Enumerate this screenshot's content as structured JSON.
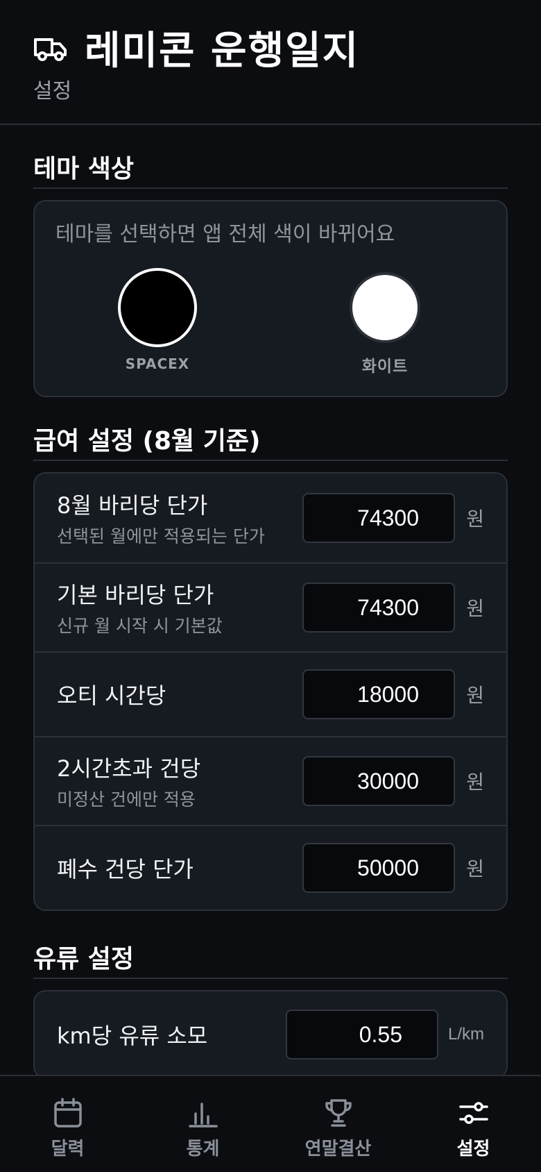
{
  "header": {
    "title": "레미콘 운행일지",
    "subtitle": "설정"
  },
  "theme": {
    "section_title": "테마 색상",
    "hint": "테마를 선택하면 앱 전체 색이 바뀌어요",
    "options": [
      {
        "label": "SPACEX",
        "color": "#000000",
        "selected": true
      },
      {
        "label": "화이트",
        "color": "#ffffff",
        "selected": false
      }
    ]
  },
  "pay": {
    "section_title": "급여 설정 (8월 기준)",
    "rows": [
      {
        "title": "8월 바리당 단가",
        "sub": "선택된 월에만 적용되는 단가",
        "value": "74300",
        "unit": "원"
      },
      {
        "title": "기본 바리당 단가",
        "sub": "신규 월 시작 시 기본값",
        "value": "74300",
        "unit": "원"
      },
      {
        "title": "오티 시간당",
        "sub": "",
        "value": "18000",
        "unit": "원"
      },
      {
        "title": "2시간초과 건당",
        "sub": "미정산 건에만 적용",
        "value": "30000",
        "unit": "원"
      },
      {
        "title": "폐수 건당 단가",
        "sub": "",
        "value": "50000",
        "unit": "원"
      }
    ]
  },
  "fuel": {
    "section_title": "유류 설정",
    "rows": [
      {
        "title": "km당 유류 소모",
        "value": "0.55",
        "unit": "L/km"
      }
    ]
  },
  "nav": {
    "items": [
      {
        "label": "달력",
        "icon": "calendar-icon",
        "active": false
      },
      {
        "label": "통계",
        "icon": "bar-chart-icon",
        "active": false
      },
      {
        "label": "연말결산",
        "icon": "trophy-icon",
        "active": false
      },
      {
        "label": "설정",
        "icon": "sliders-icon",
        "active": true
      }
    ]
  },
  "colors": {
    "background": "#0b0d11",
    "card": "#161a21",
    "border": "#2c3038",
    "muted_text": "#8f959e",
    "active_nav": "#ffffff"
  }
}
